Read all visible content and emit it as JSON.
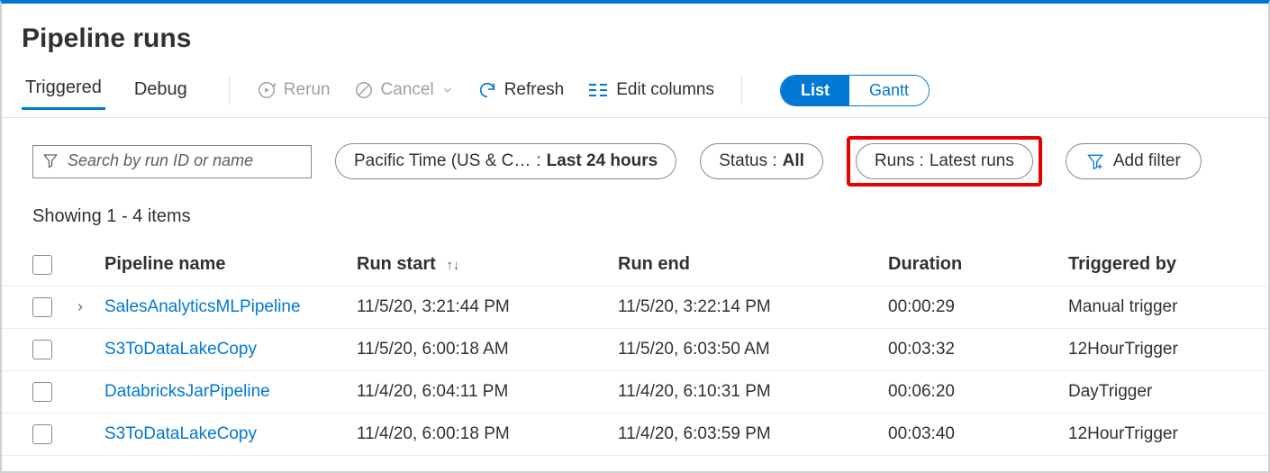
{
  "title": "Pipeline runs",
  "tabs": {
    "triggered": "Triggered",
    "debug": "Debug"
  },
  "toolbar": {
    "rerun": "Rerun",
    "cancel": "Cancel",
    "refresh": "Refresh",
    "editColumns": "Edit columns"
  },
  "viewToggle": {
    "list": "List",
    "gantt": "Gantt"
  },
  "search": {
    "placeholder": "Search by run ID or name"
  },
  "filters": {
    "timezone": {
      "prefix": "Pacific Time (US & C…",
      "sep": " : ",
      "value": "Last 24 hours"
    },
    "status": {
      "label": "Status : ",
      "value": "All"
    },
    "runs": {
      "label": "Runs : ",
      "value": "Latest runs"
    },
    "add": "Add filter"
  },
  "count": "Showing 1 - 4 items",
  "columns": {
    "name": "Pipeline name",
    "start": "Run start",
    "end": "Run end",
    "duration": "Duration",
    "triggered": "Triggered by"
  },
  "rows": [
    {
      "expandable": true,
      "name": "SalesAnalyticsMLPipeline",
      "start": "11/5/20, 3:21:44 PM",
      "end": "11/5/20, 3:22:14 PM",
      "duration": "00:00:29",
      "triggered": "Manual trigger"
    },
    {
      "expandable": false,
      "name": "S3ToDataLakeCopy",
      "start": "11/5/20, 6:00:18 AM",
      "end": "11/5/20, 6:03:50 AM",
      "duration": "00:03:32",
      "triggered": "12HourTrigger"
    },
    {
      "expandable": false,
      "name": "DatabricksJarPipeline",
      "start": "11/4/20, 6:04:11 PM",
      "end": "11/4/20, 6:10:31 PM",
      "duration": "00:06:20",
      "triggered": "DayTrigger"
    },
    {
      "expandable": false,
      "name": "S3ToDataLakeCopy",
      "start": "11/4/20, 6:00:18 PM",
      "end": "11/4/20, 6:03:59 PM",
      "duration": "00:03:40",
      "triggered": "12HourTrigger"
    }
  ]
}
